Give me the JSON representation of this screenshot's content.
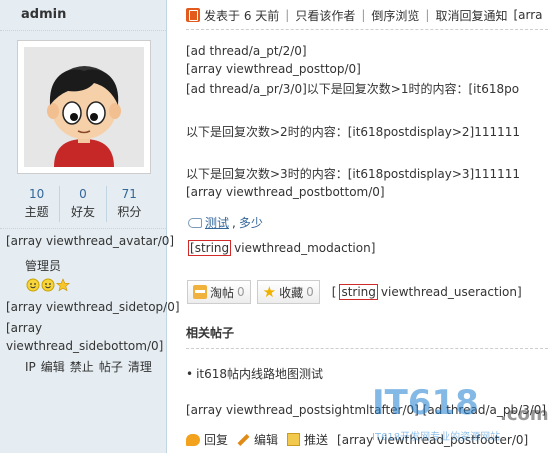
{
  "profile": {
    "username": "admin",
    "stats": [
      {
        "value": "10",
        "label": "主题"
      },
      {
        "value": "0",
        "label": "好友"
      },
      {
        "value": "71",
        "label": "积分"
      }
    ],
    "avatar_hook": "[array viewthread_avatar/0]",
    "group": "管理员",
    "medal_icons": [
      "smile-medal-icon",
      "smile-medal-icon",
      "star-medal-icon"
    ],
    "sidetop_hook": "[array viewthread_sidetop/0]",
    "sidebottom_hook": "[array viewthread_sidebottom/0]",
    "ops": [
      "IP",
      "编辑",
      "禁止",
      "帖子",
      "清理"
    ]
  },
  "post_info": {
    "posted": "发表于 6 天前",
    "author_only": "只看该作者",
    "reverse": "倒序浏览",
    "cancel_notify": "取消回复通知",
    "trailing": "[arra"
  },
  "content": {
    "line1": "[ad thread/a_pt/2/0]",
    "line2": "[array viewthread_posttop/0]",
    "line3": "[ad thread/a_pr/3/0]以下是回复次数>1时的内容：[it618po",
    "line4": "以下是回复次数>2时的内容：[it618postdisplay>2]111111",
    "line5": "以下是回复次数>3时的内容：[it618postdisplay>3]111111",
    "line6": "[array viewthread_postbottom/0]"
  },
  "tags": {
    "tag1": "测试",
    "tag2": "多少",
    "sep": ","
  },
  "modaction": {
    "boxed": "string",
    "rest": "viewthread_modaction]",
    "prefix": "["
  },
  "buttons": {
    "store_label": "淘帖",
    "store_count": "0",
    "fav_label": "收藏",
    "fav_count": "0",
    "useraction_prefix": "[",
    "useraction_boxed": "string",
    "useraction_rest": "viewthread_useraction]"
  },
  "related": {
    "title": "相关帖子",
    "items": [
      "it618帖内线路地图测试"
    ],
    "sightml": "[array viewthread_postsightmltafter/0] [ad thread/a_pb/3/0]"
  },
  "footer": {
    "reply": "回复",
    "edit": "编辑",
    "push": "推送",
    "postfooter": "[array viewthread_postfooter/0]"
  },
  "watermark": {
    "brand": "IT618",
    "domain": ".com",
    "tagline": "IT618开发网专业的资源网站"
  },
  "colors": {
    "side_bg": "#e5edf2",
    "link": "#336699",
    "boxed_border": "#d12a2a",
    "watermark": "#1f7fd1"
  }
}
